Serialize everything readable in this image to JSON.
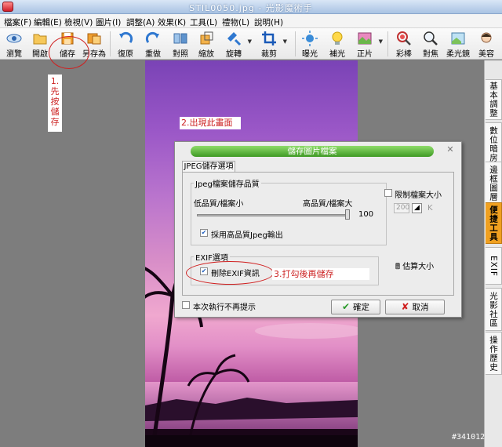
{
  "window": {
    "title": "STIL0050.jpg - 光影魔術手"
  },
  "menu": [
    "檔案(F)",
    "編輯(E)",
    "檢視(V)",
    "圖片(I)",
    "調整(A)",
    "效果(K)",
    "工具(L)",
    "禮物(L)",
    "說明(H)"
  ],
  "toolbar": {
    "browse": "瀏覽",
    "open": "開啟",
    "save": "儲存",
    "save_as": "另存為",
    "undo": "復原",
    "redo": "重做",
    "compare": "對照",
    "resize": "縮放",
    "rotate": "旋轉",
    "crop": "裁剪",
    "exposure": "曝光",
    "fill_light": "補光",
    "positive": "正片",
    "color_pen": "彩棒",
    "focus": "對焦",
    "soft_lens": "柔光鏡",
    "beauty": "美容"
  },
  "side_tabs": [
    "基本調整",
    "數位暗房",
    "邊框圖層",
    "便捷工具",
    "EXIF",
    "光影社區",
    "操作歷史"
  ],
  "annotations": {
    "step1": "1.先按儲存",
    "step2": "2.出現此畫面",
    "step3": "3.打勾後再儲存"
  },
  "dialog": {
    "title": "儲存圖片檔案",
    "tab": "JPEG儲存選項",
    "quality_group": "Jpeg檔案儲存品質",
    "low_quality": "低品質/檔案小",
    "high_quality": "高品質/檔案大",
    "quality_value": "100",
    "quality_fraction": 1.0,
    "use_high_quality": "採用高品質Jpeg輸出",
    "use_high_quality_checked": true,
    "limit_size": "限制檔案大小",
    "limit_size_checked": false,
    "size_value": "200",
    "size_unit": "K",
    "exif_group": "EXIF選項",
    "delete_exif": "刪除EXIF資訊",
    "delete_exif_checked": true,
    "estimate_size": "估算大小",
    "dont_show": "本次執行不再提示",
    "dont_show_checked": false,
    "ok": "確定",
    "cancel": "取消"
  },
  "watermark": "#341012"
}
